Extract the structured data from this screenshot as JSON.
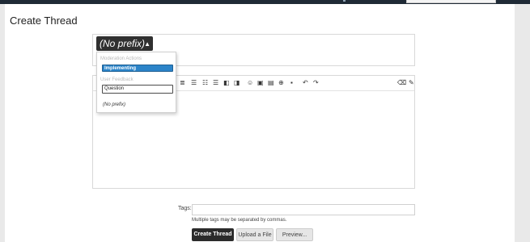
{
  "page": {
    "title": "Create Thread"
  },
  "prefix": {
    "selected": "(No prefix)",
    "groups": [
      {
        "label": "Moderation Actions",
        "items": [
          "Implementing"
        ]
      },
      {
        "label": "User Feedback",
        "items": [
          "Question"
        ]
      }
    ],
    "none_option": "(No prefix)"
  },
  "toolbar": {
    "icons": [
      "align-justify-icon",
      "bulleted-list-icon",
      "numbered-list-icon",
      "outdent-icon",
      "indent-icon",
      "smilies-icon",
      "image-icon",
      "media-icon",
      "insert-icon",
      "save-draft-icon",
      "undo-icon",
      "redo-icon",
      "remove-formatting-icon",
      "wrench-icon"
    ]
  },
  "tags": {
    "label": "Tags:",
    "value": "",
    "hint": "Multiple tags may be separated by commas."
  },
  "buttons": {
    "create": "Create Thread",
    "upload": "Upload a File",
    "preview": "Preview..."
  },
  "colors": {
    "top_bar": "#1f2a36",
    "selected_prefix": "#2b84c9",
    "primary_button": "#2b2b2b"
  }
}
